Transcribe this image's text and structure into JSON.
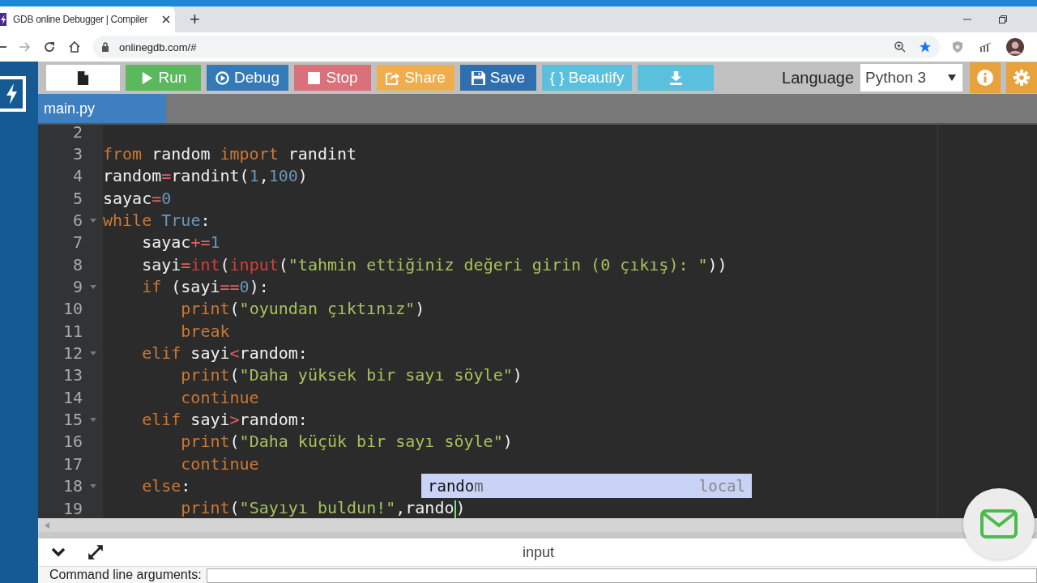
{
  "browser": {
    "tab_title": "GDB online Debugger | Compiler",
    "new_tab": "+",
    "url": "onlinegdb.com/#"
  },
  "toolbar": {
    "buttons": [
      {
        "kind": "new"
      },
      {
        "kind": "run",
        "label": "Run"
      },
      {
        "kind": "debug",
        "label": "Debug"
      },
      {
        "kind": "stop",
        "label": "Stop"
      },
      {
        "kind": "share",
        "label": "Share"
      },
      {
        "kind": "save",
        "label": "Save"
      },
      {
        "kind": "beautify",
        "label": "{ } Beautify"
      },
      {
        "kind": "download"
      }
    ],
    "language": {
      "label": "Language",
      "value": "Python 3"
    }
  },
  "file_tabs": [
    {
      "label": "main.py",
      "selected": true
    }
  ],
  "editor": {
    "lines": [
      {
        "number": "2",
        "foldable": false
      },
      {
        "number": "3",
        "foldable": false,
        "tokens": [
          {
            "kind": "kw",
            "text": "from"
          },
          {
            "kind": "name",
            "text": " random "
          },
          {
            "kind": "kw",
            "text": "import"
          },
          {
            "kind": "name",
            "text": " randint"
          }
        ]
      },
      {
        "number": "4",
        "foldable": false,
        "tokens": [
          {
            "kind": "name",
            "text": "random"
          },
          {
            "kind": "op",
            "text": "="
          },
          {
            "kind": "name",
            "text": "randint("
          },
          {
            "kind": "num",
            "text": "1"
          },
          {
            "kind": "name",
            "text": ","
          },
          {
            "kind": "num",
            "text": "100"
          },
          {
            "kind": "name",
            "text": ")"
          }
        ]
      },
      {
        "number": "5",
        "foldable": false,
        "tokens": [
          {
            "kind": "name",
            "text": "sayac"
          },
          {
            "kind": "op",
            "text": "="
          },
          {
            "kind": "num",
            "text": "0"
          }
        ]
      },
      {
        "number": "6",
        "foldable": true,
        "tokens": [
          {
            "kind": "kw",
            "text": "while"
          },
          {
            "kind": "const",
            "text": " True"
          },
          {
            "kind": "name",
            "text": ":"
          }
        ]
      },
      {
        "number": "7",
        "foldable": false,
        "tokens": [
          {
            "kind": "name",
            "text": "    sayac"
          },
          {
            "kind": "op",
            "text": "+="
          },
          {
            "kind": "num",
            "text": "1"
          }
        ]
      },
      {
        "number": "8",
        "foldable": false,
        "tokens": [
          {
            "kind": "name",
            "text": "    sayi"
          },
          {
            "kind": "op",
            "text": "="
          },
          {
            "kind": "builtin",
            "text": "int"
          },
          {
            "kind": "name",
            "text": "("
          },
          {
            "kind": "builtin",
            "text": "input"
          },
          {
            "kind": "name",
            "text": "("
          },
          {
            "kind": "str",
            "text": "\"tahmin ettiğiniz değeri girin (0 çıkış): \""
          },
          {
            "kind": "name",
            "text": "))"
          }
        ]
      },
      {
        "number": "9",
        "foldable": true,
        "tokens": [
          {
            "kind": "kw",
            "text": "    if"
          },
          {
            "kind": "name",
            "text": " (sayi"
          },
          {
            "kind": "op",
            "text": "=="
          },
          {
            "kind": "num",
            "text": "0"
          },
          {
            "kind": "name",
            "text": "):"
          }
        ]
      },
      {
        "number": "10",
        "foldable": false,
        "tokens": [
          {
            "kind": "kw",
            "text": "        print"
          },
          {
            "kind": "name",
            "text": "("
          },
          {
            "kind": "str",
            "text": "\"oyundan çıktınız\""
          },
          {
            "kind": "name",
            "text": ")"
          }
        ]
      },
      {
        "number": "11",
        "foldable": false,
        "tokens": [
          {
            "kind": "kw",
            "text": "        break"
          }
        ]
      },
      {
        "number": "12",
        "foldable": true,
        "tokens": [
          {
            "kind": "kw",
            "text": "    elif"
          },
          {
            "kind": "name",
            "text": " sayi"
          },
          {
            "kind": "op",
            "text": "<"
          },
          {
            "kind": "name",
            "text": "random:"
          }
        ]
      },
      {
        "number": "13",
        "foldable": false,
        "tokens": [
          {
            "kind": "kw",
            "text": "        print"
          },
          {
            "kind": "name",
            "text": "("
          },
          {
            "kind": "str",
            "text": "\"Daha yüksek bir sayı söyle\""
          },
          {
            "kind": "name",
            "text": ")"
          }
        ]
      },
      {
        "number": "14",
        "foldable": false,
        "tokens": [
          {
            "kind": "kw",
            "text": "        continue"
          }
        ]
      },
      {
        "number": "15",
        "foldable": true,
        "tokens": [
          {
            "kind": "kw",
            "text": "    elif"
          },
          {
            "kind": "name",
            "text": " sayi"
          },
          {
            "kind": "op",
            "text": ">"
          },
          {
            "kind": "name",
            "text": "random:"
          }
        ]
      },
      {
        "number": "16",
        "foldable": false,
        "tokens": [
          {
            "kind": "kw",
            "text": "        print"
          },
          {
            "kind": "name",
            "text": "("
          },
          {
            "kind": "str",
            "text": "\"Daha küçük bir sayı söyle\""
          },
          {
            "kind": "name",
            "text": ")"
          }
        ]
      },
      {
        "number": "17",
        "foldable": false,
        "tokens": [
          {
            "kind": "kw",
            "text": "        continue"
          }
        ]
      },
      {
        "number": "18",
        "foldable": true,
        "tokens": [
          {
            "kind": "kw",
            "text": "    else"
          },
          {
            "kind": "name",
            "text": ":"
          }
        ]
      },
      {
        "number": "19",
        "foldable": false,
        "tokens": [
          {
            "kind": "kw",
            "text": "        print"
          },
          {
            "kind": "name",
            "text": "("
          },
          {
            "kind": "str",
            "text": "\"Sayıyı buldun!\""
          },
          {
            "kind": "name",
            "text": ",rando",
            "caret_after": true
          },
          {
            "kind": "name",
            "text": ")"
          }
        ]
      }
    ],
    "autocomplete": {
      "typed": "rando",
      "rest": "m",
      "source": "local"
    }
  },
  "io_panel": {
    "tab_label": "input",
    "args_label": "Command line arguments:"
  }
}
